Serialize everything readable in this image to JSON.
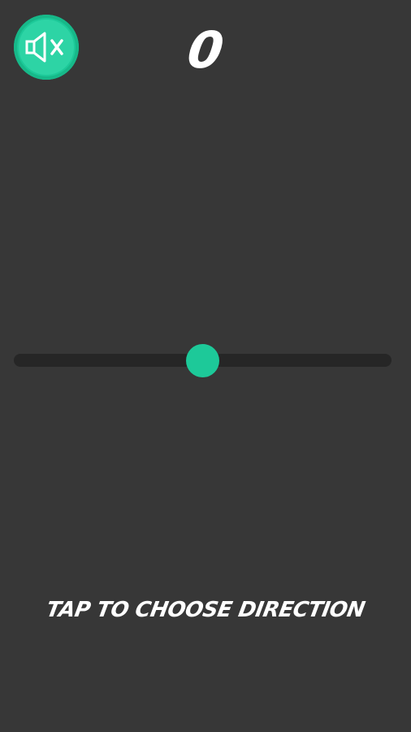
{
  "hud": {
    "score": "0",
    "mute_icon": "speaker-muted-icon",
    "mute_state": "muted"
  },
  "game": {
    "instruction": "TAP TO CHOOSE DIRECTION",
    "ball_position_fraction": 0.5
  },
  "colors": {
    "background": "#373737",
    "accent": "#1dc999",
    "track": "#262626",
    "text": "#ffffff"
  }
}
